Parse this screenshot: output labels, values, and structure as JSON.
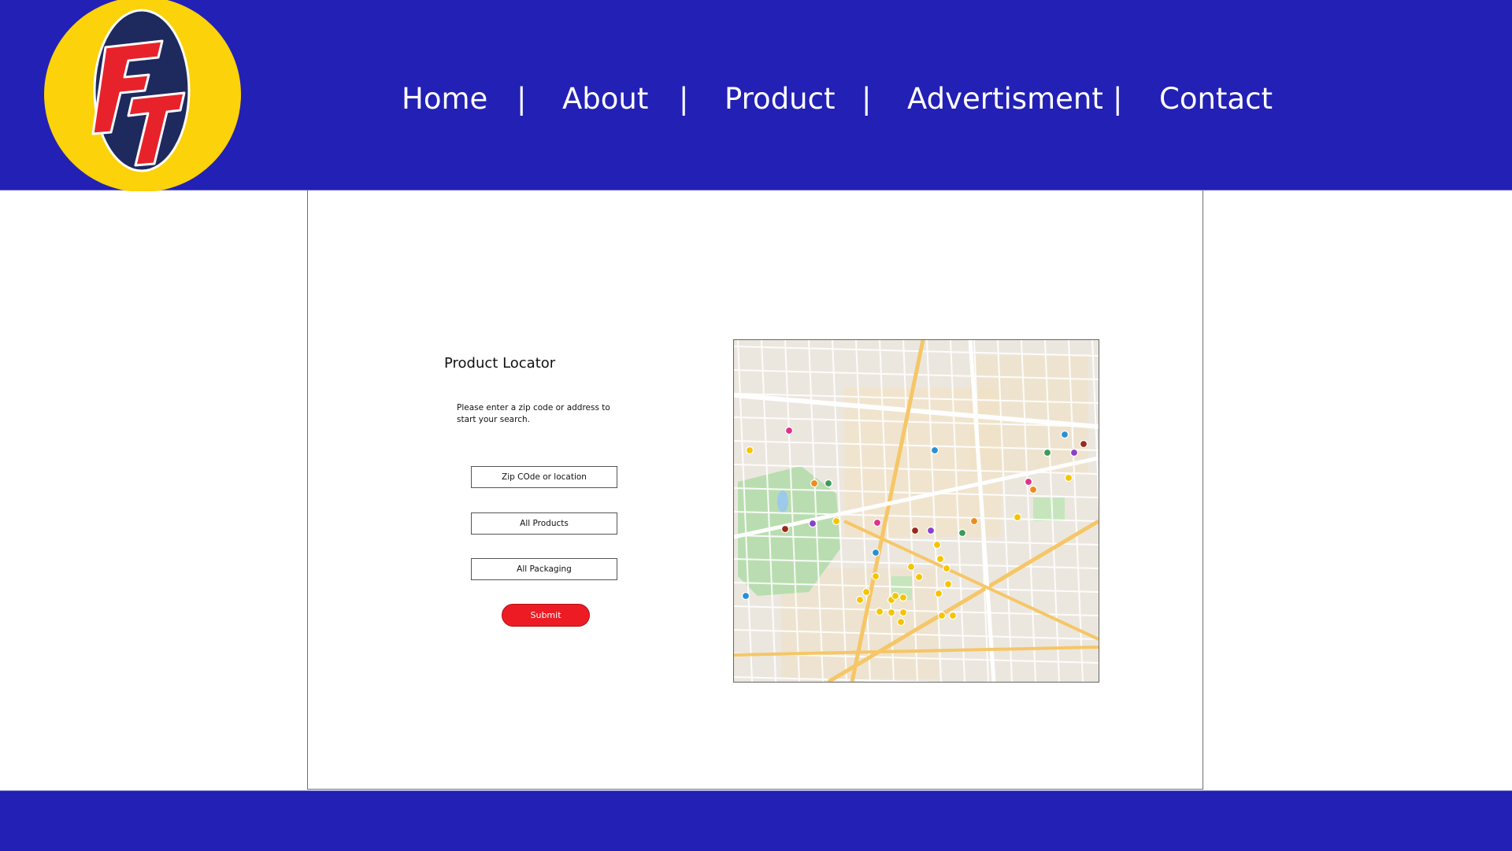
{
  "brand": {
    "logo_text": "FT",
    "logo_colors": {
      "outer": "#fcd20a",
      "inner": "#1e2a5e",
      "letters": "#e8222b"
    }
  },
  "nav": {
    "items": [
      {
        "label": "Home"
      },
      {
        "label": "About"
      },
      {
        "label": "Product"
      },
      {
        "label": "Advertisment"
      },
      {
        "label": "Contact"
      }
    ],
    "separator": "|"
  },
  "locator": {
    "title": "Product Locator",
    "instructions": "Please enter a zip code or address to start your search.",
    "zip_placeholder": "Zip COde or location",
    "products_value": "All Products",
    "packaging_value": "All Packaging",
    "submit_label": "Submit"
  },
  "map": {
    "icon": "city-street-map",
    "marker_colors": [
      "#f5c400",
      "#e0308b",
      "#2a8fd6",
      "#9a2a1a",
      "#8b3fc8",
      "#3b9b5a",
      "#f08a1c"
    ]
  },
  "colors": {
    "header_bg": "#2320b5",
    "footer_bg": "#2320b5",
    "accent": "#ed1c24"
  }
}
